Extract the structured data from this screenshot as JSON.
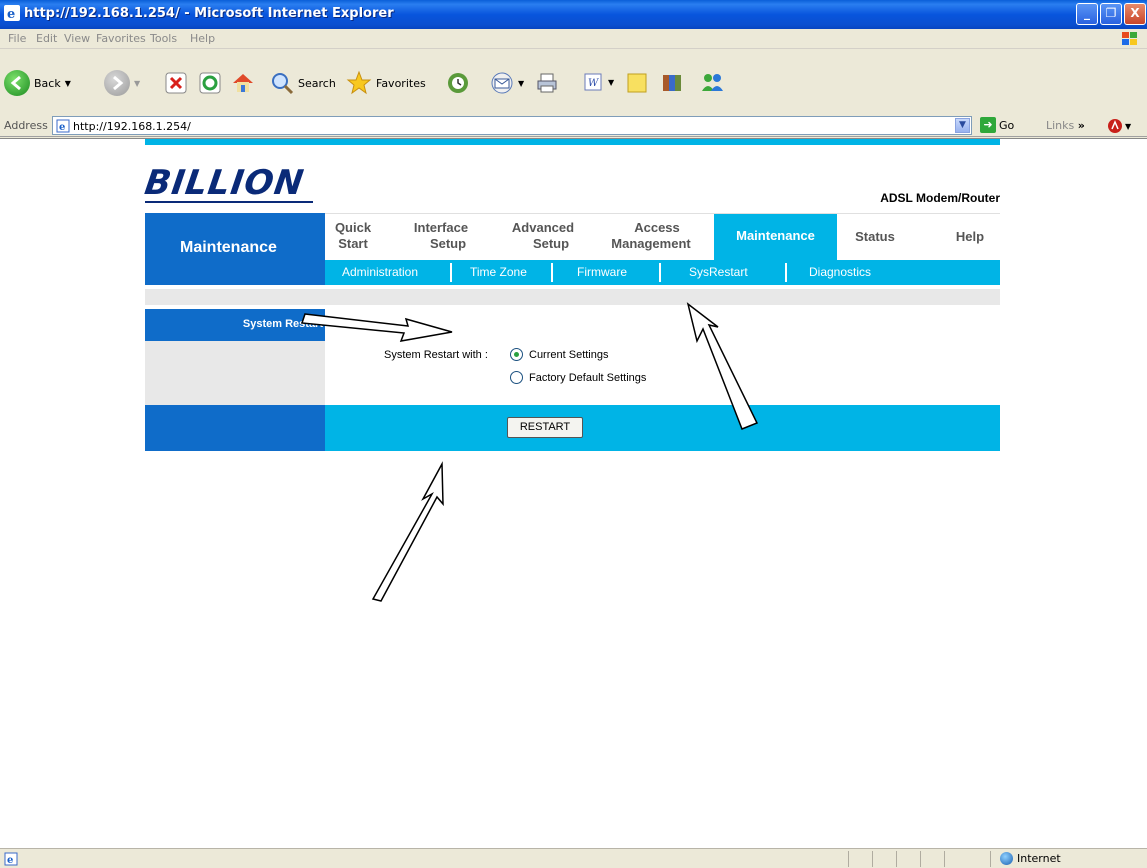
{
  "window": {
    "title": "http://192.168.1.254/ - Microsoft Internet Explorer",
    "minimize": "_",
    "restore": "❐",
    "close": "X"
  },
  "menu": [
    "File",
    "Edit",
    "View",
    "Favorites",
    "Tools",
    "Help"
  ],
  "toolbar": {
    "back": "Back",
    "search": "Search",
    "favorites": "Favorites"
  },
  "address": {
    "label": "Address",
    "url": "http://192.168.1.254/",
    "go": "Go",
    "links": "Links"
  },
  "router": {
    "logo": "BILLION",
    "product": "ADSL Modem/Router",
    "section": "Maintenance",
    "nav": [
      {
        "label_line1": "Quick",
        "label_line2": "Start"
      },
      {
        "label_line1": "Interface",
        "label_line2": "Setup"
      },
      {
        "label_line1": "Advanced",
        "label_line2": "Setup"
      },
      {
        "label_line1": "Access",
        "label_line2": "Management"
      },
      {
        "label_line1": "Maintenance",
        "label_line2": ""
      },
      {
        "label_line1": "Status",
        "label_line2": ""
      },
      {
        "label_line1": "Help",
        "label_line2": ""
      }
    ],
    "subnav": [
      "Administration",
      "Time Zone",
      "Firmware",
      "SysRestart",
      "Diagnostics"
    ],
    "panel_title": "System Restart",
    "restart_with_label": "System Restart with :",
    "options": [
      {
        "label": "Current Settings",
        "selected": true
      },
      {
        "label": "Factory Default Settings",
        "selected": false
      }
    ],
    "restart_button": "RESTART"
  },
  "status": {
    "zone": "Internet"
  }
}
